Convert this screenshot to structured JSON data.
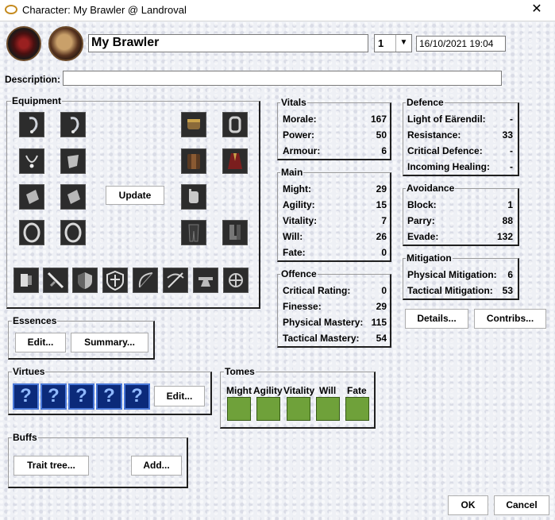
{
  "window": {
    "title": "Character: My Brawler @ Landroval",
    "close_glyph": "✕"
  },
  "header": {
    "name": "My Brawler",
    "level": "1",
    "date": "16/10/2021 19:04",
    "description_label": "Description:",
    "description_value": ""
  },
  "equipment": {
    "label": "Equipment",
    "update_label": "Update"
  },
  "vitals": {
    "label": "Vitals",
    "rows": [
      {
        "k": "Morale:",
        "v": "167"
      },
      {
        "k": "Power:",
        "v": "50"
      },
      {
        "k": "Armour:",
        "v": "6"
      }
    ]
  },
  "main": {
    "label": "Main",
    "rows": [
      {
        "k": "Might:",
        "v": "29"
      },
      {
        "k": "Agility:",
        "v": "15"
      },
      {
        "k": "Vitality:",
        "v": "7"
      },
      {
        "k": "Will:",
        "v": "26"
      },
      {
        "k": "Fate:",
        "v": "0"
      }
    ]
  },
  "offence": {
    "label": "Offence",
    "rows": [
      {
        "k": "Critical Rating:",
        "v": "0"
      },
      {
        "k": "Finesse:",
        "v": "29"
      },
      {
        "k": "Physical Mastery:",
        "v": "115"
      },
      {
        "k": "Tactical Mastery:",
        "v": "54"
      }
    ]
  },
  "defence": {
    "label": "Defence",
    "rows": [
      {
        "k": "Light of Eärendil:",
        "v": "-"
      },
      {
        "k": "Resistance:",
        "v": "33"
      },
      {
        "k": "Critical Defence:",
        "v": "-"
      },
      {
        "k": "Incoming Healing:",
        "v": "-"
      }
    ]
  },
  "avoidance": {
    "label": "Avoidance",
    "rows": [
      {
        "k": "Block:",
        "v": "1"
      },
      {
        "k": "Parry:",
        "v": "88"
      },
      {
        "k": "Evade:",
        "v": "132"
      }
    ]
  },
  "mitigation": {
    "label": "Mitigation",
    "rows": [
      {
        "k": "Physical Mitigation:",
        "v": "6"
      },
      {
        "k": "Tactical Mitigation:",
        "v": "53"
      }
    ]
  },
  "stats_buttons": {
    "details": "Details...",
    "contribs": "Contribs..."
  },
  "essences": {
    "label": "Essences",
    "edit": "Edit...",
    "summary": "Summary..."
  },
  "virtues": {
    "label": "Virtues",
    "slot_glyph": "?",
    "edit": "Edit..."
  },
  "tomes": {
    "label": "Tomes",
    "names": [
      "Might",
      "Agility",
      "Vitality",
      "Will",
      "Fate"
    ]
  },
  "buffs": {
    "label": "Buffs",
    "trait_tree": "Trait tree...",
    "add": "Add..."
  },
  "footer": {
    "ok": "OK",
    "cancel": "Cancel"
  },
  "colors": {
    "virtue_bg": "#0b2a7a",
    "tome_green": "#6fa13a",
    "slot_dark": "#2c2c2c"
  }
}
